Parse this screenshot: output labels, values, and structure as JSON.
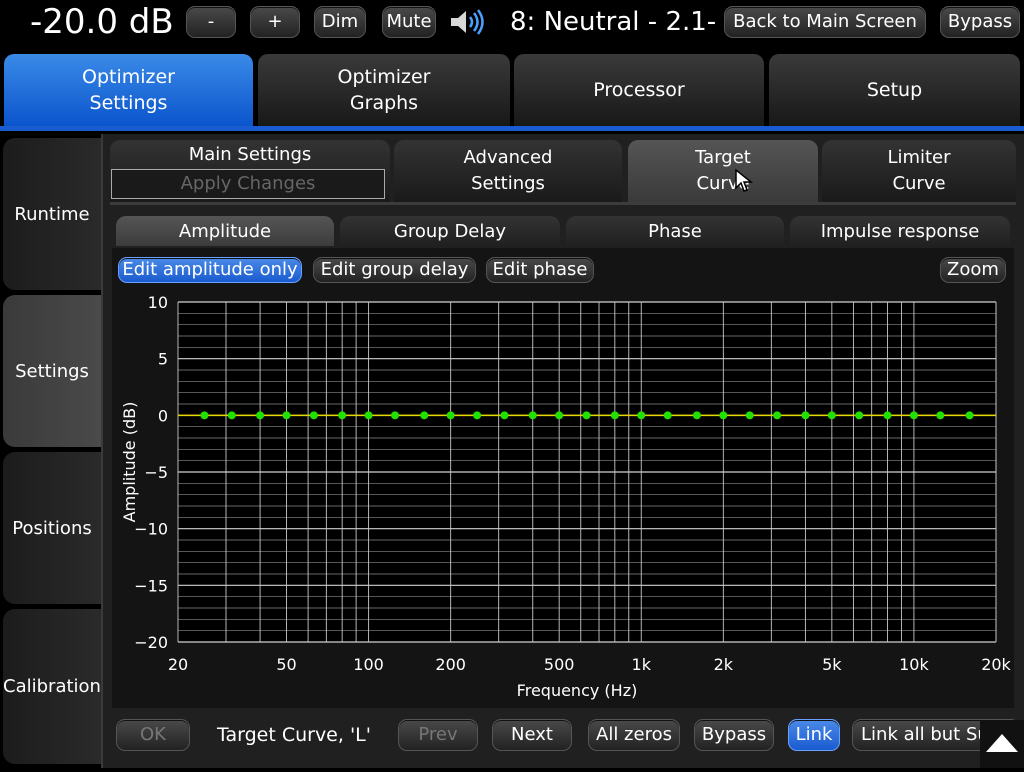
{
  "topbar": {
    "volume": "-20.0 dB",
    "minus_label": "-",
    "plus_label": "+",
    "dim_label": "Dim",
    "mute_label": "Mute",
    "preset": "8: Neutral - 2.1-",
    "back_label": "Back to Main Screen",
    "bypass_label": "Bypass"
  },
  "main_tabs": [
    {
      "line1": "Optimizer",
      "line2": "Settings"
    },
    {
      "line1": "Optimizer",
      "line2": "Graphs"
    },
    {
      "line1": "Processor",
      "line2": ""
    },
    {
      "line1": "Setup",
      "line2": ""
    }
  ],
  "sidebar": [
    "Runtime",
    "Settings",
    "Positions",
    "Calibration"
  ],
  "settings_tabs": {
    "main": "Main Settings",
    "apply": "Apply Changes",
    "advanced_1": "Advanced",
    "advanced_2": "Settings",
    "target_1": "Target",
    "target_2": "Curve",
    "limiter_1": "Limiter",
    "limiter_2": "Curve"
  },
  "graph_tabs": [
    "Amplitude",
    "Group Delay",
    "Phase",
    "Impulse response"
  ],
  "edit_buttons": {
    "amplitude": "Edit amplitude only",
    "group_delay": "Edit group delay",
    "phase": "Edit phase",
    "zoom": "Zoom"
  },
  "bottom": {
    "ok": "OK",
    "curve_label": "Target Curve, 'L'",
    "prev": "Prev",
    "next": "Next",
    "all_zeros": "All zeros",
    "bypass": "Bypass",
    "link": "Link",
    "link_all": "Link all but Sub"
  },
  "colors": {
    "accent": "#1a5bd0",
    "curve": "#e6d600",
    "points": "#22e000"
  },
  "chart_data": {
    "type": "line",
    "xlabel": "Frequency (Hz)",
    "ylabel": "Amplitude (dB)",
    "xscale": "log",
    "xlim": [
      20,
      20000
    ],
    "ylim": [
      -20,
      10
    ],
    "x_ticks": [
      20,
      50,
      100,
      200,
      500,
      1000,
      2000,
      5000,
      10000,
      20000
    ],
    "x_tick_labels": [
      "20",
      "50",
      "100",
      "200",
      "500",
      "1k",
      "2k",
      "5k",
      "10k",
      "20k"
    ],
    "y_ticks": [
      10,
      5,
      0,
      -5,
      -10,
      -15,
      -20
    ],
    "y_tick_labels": [
      "10",
      "5",
      "0",
      "−5",
      "−10",
      "−15",
      "−20"
    ],
    "grid": true,
    "series": [
      {
        "x": [
          25,
          31.5,
          40,
          50,
          63,
          80,
          100,
          125,
          160,
          200,
          250,
          315,
          400,
          500,
          630,
          800,
          1000,
          1250,
          1600,
          2000,
          2500,
          3150,
          4000,
          5000,
          6300,
          8000,
          10000,
          12500,
          16000
        ],
        "y": [
          0,
          0,
          0,
          0,
          0,
          0,
          0,
          0,
          0,
          0,
          0,
          0,
          0,
          0,
          0,
          0,
          0,
          0,
          0,
          0,
          0,
          0,
          0,
          0,
          0,
          0,
          0,
          0,
          0
        ]
      }
    ]
  }
}
